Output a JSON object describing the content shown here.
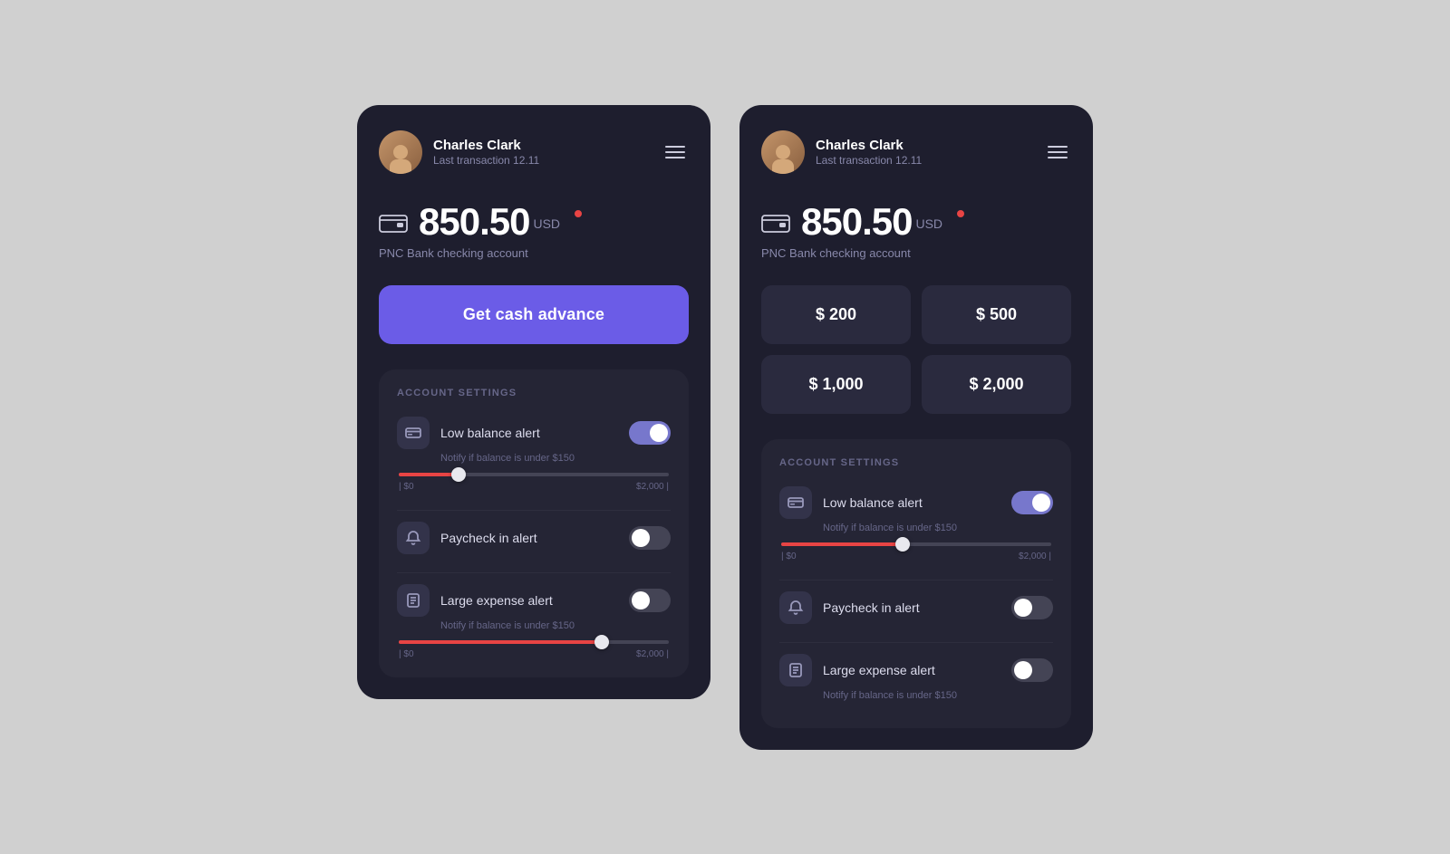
{
  "screen1": {
    "header": {
      "user_name": "Charles Clark",
      "user_sub": "Last transaction 12.11",
      "menu_aria": "Menu"
    },
    "balance": {
      "amount": "850.50",
      "currency": "USD",
      "label": "PNC Bank checking account"
    },
    "cta_button": "Get cash advance",
    "settings": {
      "title": "ACCOUNT SETTINGS",
      "items": [
        {
          "name": "Low balance alert",
          "sub": "Notify if balance is under $150",
          "toggle": "on",
          "has_slider": true,
          "slider_pct": 22,
          "slider_min": "$0",
          "slider_max": "$2,000"
        },
        {
          "name": "Paycheck in alert",
          "sub": "",
          "toggle": "off",
          "has_slider": false
        },
        {
          "name": "Large expense alert",
          "sub": "Notify if balance is under $150",
          "toggle": "off",
          "has_slider": true,
          "slider_pct": 75,
          "slider_min": "$0",
          "slider_max": "$2,000"
        }
      ]
    }
  },
  "screen2": {
    "header": {
      "user_name": "Charles Clark",
      "user_sub": "Last transaction 12.11",
      "menu_aria": "Menu"
    },
    "balance": {
      "amount": "850.50",
      "currency": "USD",
      "label": "PNC Bank checking account"
    },
    "amounts": [
      "$ 200",
      "$ 500",
      "$ 1,000",
      "$ 2,000"
    ],
    "settings": {
      "title": "ACCOUNT SETTINGS",
      "items": [
        {
          "name": "Low balance alert",
          "sub": "Notify if balance is under $150",
          "toggle": "on",
          "has_slider": true,
          "slider_pct": 45,
          "slider_min": "$0",
          "slider_max": "$2,000"
        },
        {
          "name": "Paycheck in alert",
          "sub": "",
          "toggle": "off",
          "has_slider": false
        },
        {
          "name": "Large expense alert",
          "sub": "Notify if balance is under $150",
          "toggle": "off",
          "has_slider": false
        }
      ]
    }
  }
}
